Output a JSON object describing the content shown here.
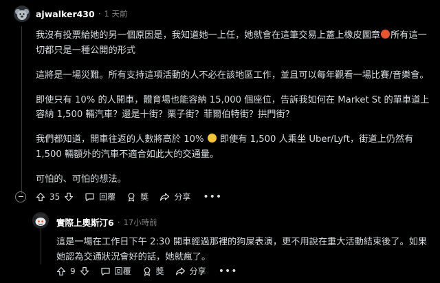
{
  "comment": {
    "username": "ajwalker430",
    "time": "1 天前",
    "paragraphs": [
      {
        "text": "我沒有投票給她的另一個原因是，我知道她一上任，她就會在這筆交易上蓋上橡皮圖章",
        "emoji": "angry-face",
        "after": "所有這一切都只是一種公開的形式"
      },
      {
        "text": "這將是一場災難。所有支持這項活動的人不必在該地區工作，並且可以每年觀看一場比賽/音樂會。"
      },
      {
        "text": "即使只有 10% 的人開車，體育場也能容納 15,000 個座位，告訴我如何在 Market St 的單車道上容納 1,500 輛汽車？還是十街？栗子街？菲爾伯特街？拱門街？"
      },
      {
        "text": "我們都知道，開車往返的人數將高於 10%",
        "emoji": "grimacing-face",
        "after": " 即使有 1,500 人乘坐 Uber/Lyft，街道上仍然有 1,500 輛額外的汽車不適合如此大的交通量。"
      },
      {
        "text": "可怕的、可怕的想法。"
      }
    ],
    "actions": {
      "votes": "35",
      "reply": "回覆",
      "award": "獎",
      "share": "分享",
      "more": "•••"
    }
  },
  "reply": {
    "username": "實際上奧斯汀6",
    "time": "17小時前",
    "text": "這是一場在工作日下午 2:30 開車經過那裡的狗屎表演，更不用說在重大活動結束後了。如果她認為交通狀況會好的話，她就瘋了。",
    "actions": {
      "votes": "9",
      "reply": "回覆",
      "award": "獎",
      "share": "分享",
      "more": "•••"
    }
  }
}
